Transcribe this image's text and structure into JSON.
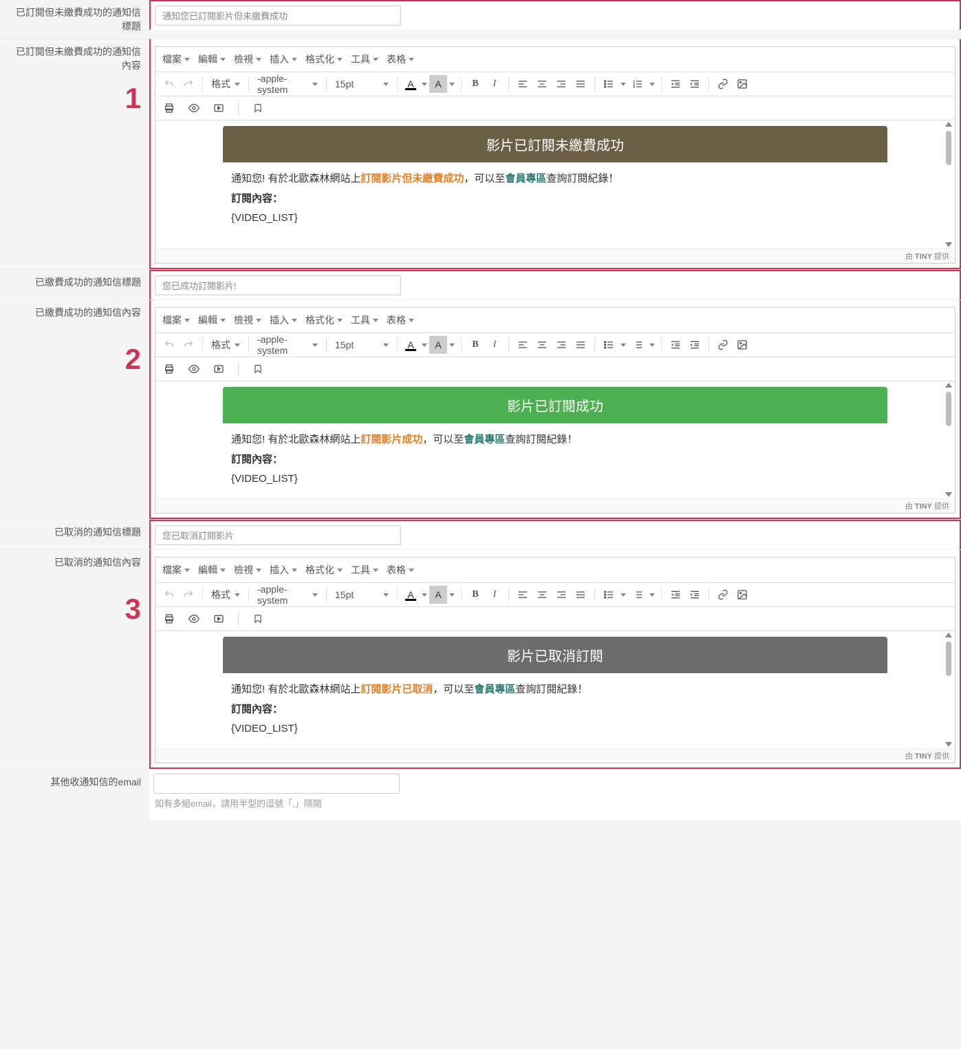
{
  "labels": {
    "sec1_title_label": "已訂閱但未繳費成功的通知信標題",
    "sec1_content_label": "已訂閱但未繳費成功的通知信內容",
    "sec2_title_label": "已繳費成功的通知信標題",
    "sec2_content_label": "已繳費成功的通知信內容",
    "sec3_title_label": "已取消的通知信標題",
    "sec3_content_label": "已取消的通知信內容",
    "other_email_label": "其他收通知信的email",
    "other_email_helper": "如有多組email，請用半型的逗號「,」隔開"
  },
  "numbers": {
    "n1": "1",
    "n2": "2",
    "n3": "3"
  },
  "inputs": {
    "sec1_title": "通知您已訂閱影片但未繳費成功",
    "sec2_title": "您已成功訂閱影片!",
    "sec3_title": "您已取消訂閱影片",
    "other_email": ""
  },
  "menu": {
    "file": "檔案",
    "edit": "編輯",
    "view": "檢視",
    "insert": "插入",
    "format": "格式化",
    "tools": "工具",
    "table": "表格"
  },
  "toolbar": {
    "style": "格式",
    "font": "-apple-system",
    "size": "15pt",
    "color_letter": "A",
    "bold": "B",
    "italic": "I"
  },
  "tiny": {
    "prefix": "由 ",
    "brand": "TINY",
    "suffix": " 提供"
  },
  "content": {
    "sec1": {
      "banner": "影片已訂閱未繳費成功",
      "line1a": "通知您! 有於北歐森林網站上",
      "line1b": "訂閱影片但未繳費成功",
      "line1c": "，可以至",
      "line1d": "會員專區",
      "line1e": "查詢訂閱紀錄！",
      "line2": "訂閱內容：",
      "line3": "{VIDEO_LIST}"
    },
    "sec2": {
      "banner": "影片已訂閱成功",
      "line1a": "通知您! 有於北歐森林網站上",
      "line1b": "訂閱影片成功",
      "line1c": "，可以至",
      "line1d": "會員專區",
      "line1e": "查詢訂閱紀錄！",
      "line2": "訂閱內容：",
      "line3": "{VIDEO_LIST}"
    },
    "sec3": {
      "banner": "影片已取消訂閱",
      "line1a": "通知您! 有於北歐森林網站上",
      "line1b": "訂閱影片已取消",
      "line1c": "，可以至",
      "line1d": "會員專區",
      "line1e": "查詢訂閱紀錄！",
      "line2": "訂閱內容：",
      "line3": "{VIDEO_LIST}"
    }
  }
}
